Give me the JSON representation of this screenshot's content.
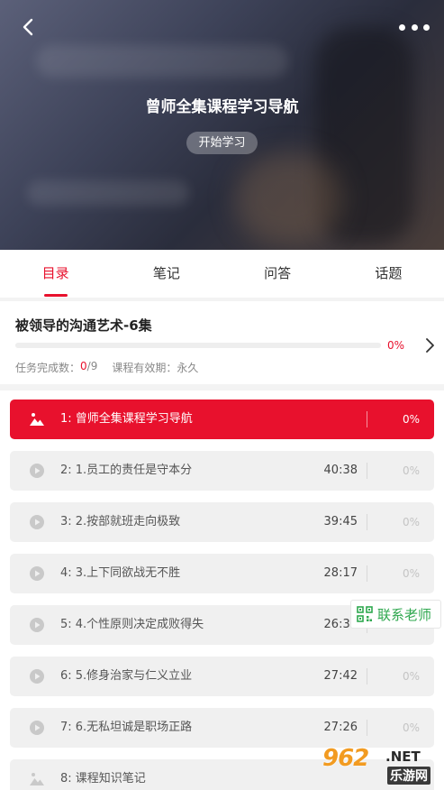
{
  "header": {
    "title": "曾师全集课程学习导航",
    "start_label": "开始学习",
    "back_icon": "chevron-left-icon",
    "more_icon": "more-dots-icon"
  },
  "tabs": [
    {
      "label": "目录",
      "active": true
    },
    {
      "label": "笔记",
      "active": false
    },
    {
      "label": "问答",
      "active": false
    },
    {
      "label": "话题",
      "active": false
    }
  ],
  "course": {
    "title": "被领导的沟通艺术-6集",
    "progress_percent": 0,
    "progress_label": "0%",
    "tasks_label": "任务完成数：",
    "tasks_done": "0",
    "tasks_total": "/9",
    "validity_label": "课程有效期：",
    "validity_value": "永久"
  },
  "items": [
    {
      "label": "1: 曾师全集课程学习导航",
      "duration": "",
      "percent": "0%",
      "icon": "image-icon",
      "active": true
    },
    {
      "label": "2: 1.员工的责任是守本分",
      "duration": "40:38",
      "percent": "0%",
      "icon": "play-icon",
      "active": false
    },
    {
      "label": "3: 2.按部就班走向极致",
      "duration": "39:45",
      "percent": "0%",
      "icon": "play-icon",
      "active": false
    },
    {
      "label": "4: 3.上下同欲战无不胜",
      "duration": "28:17",
      "percent": "0%",
      "icon": "play-icon",
      "active": false
    },
    {
      "label": "5: 4.个性原则决定成败得失",
      "duration": "26:39",
      "percent": "0%",
      "icon": "play-icon",
      "active": false
    },
    {
      "label": "6: 5.修身治家与仁义立业",
      "duration": "27:42",
      "percent": "0%",
      "icon": "play-icon",
      "active": false
    },
    {
      "label": "7: 6.无私坦诚是职场正路",
      "duration": "27:26",
      "percent": "0%",
      "icon": "play-icon",
      "active": false
    },
    {
      "label": "8: 课程知识笔记",
      "duration": "",
      "percent": "",
      "icon": "image-icon",
      "active": false
    }
  ],
  "contact": {
    "label": "联系老师",
    "icon": "qr-code-icon"
  },
  "watermark": {
    "number": "962",
    "net": ".NET",
    "cn": "乐游网"
  },
  "colors": {
    "accent": "#e8112d",
    "contact_green": "#2fa84f",
    "watermark_orange": "#f29b21"
  }
}
